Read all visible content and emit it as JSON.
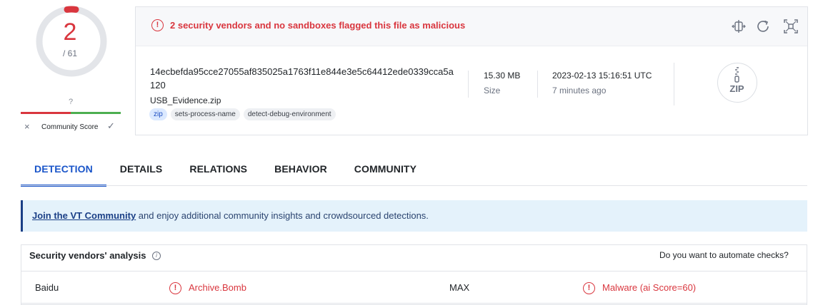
{
  "score": {
    "detections": "2",
    "total": "/ 61"
  },
  "community": {
    "unknown": "?",
    "label": "Community Score",
    "negative_icon": "×",
    "positive_icon": "✓"
  },
  "alert": {
    "icon": "!",
    "text": "2 security vendors and no sandboxes flagged this file as malicious"
  },
  "toolbar": {
    "icons": [
      "compare-icon",
      "reanalyze-icon",
      "similar-icon"
    ]
  },
  "file": {
    "hash": "14ecbefda95cce27055af835025a1763f11e844e3e5c64412ede0339cca5a120",
    "name": "USB_Evidence.zip",
    "tags": [
      "zip",
      "sets-process-name",
      "detect-debug-environment"
    ],
    "size_value": "15.30 MB",
    "size_label": "Size",
    "date_value": "2023-02-13 15:16:51 UTC",
    "date_label": "7 minutes ago",
    "type_icon_text": "ZIP"
  },
  "tabs": [
    "DETECTION",
    "DETAILS",
    "RELATIONS",
    "BEHAVIOR",
    "COMMUNITY"
  ],
  "banner": {
    "link": "Join the VT Community",
    "text": " and enjoy additional community insights and crowdsourced detections."
  },
  "vendors": {
    "title": "Security vendors' analysis",
    "automate": "Do you want to automate checks?",
    "rows": [
      {
        "vendor1": "Baidu",
        "result1": "Archive.Bomb",
        "vendor2": "MAX",
        "result2": "Malware (ai Score=60)"
      }
    ]
  },
  "colors": {
    "danger": "#d9363e",
    "accent": "#1a55c9",
    "positive": "#4caf50"
  }
}
